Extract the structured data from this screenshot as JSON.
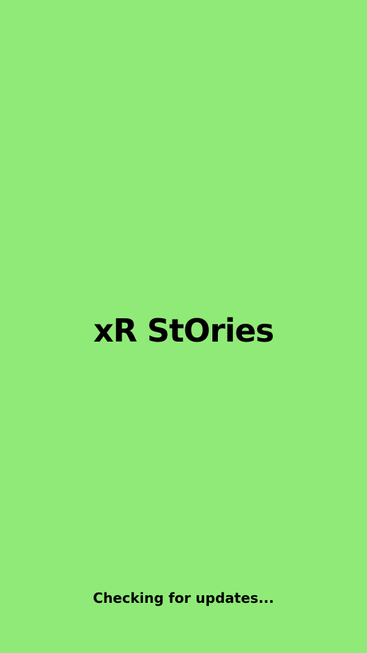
{
  "splash": {
    "logo_text": "xR StOries",
    "status_text": "Checking for updates...",
    "background_color": "#90EA78",
    "text_color": "#000000"
  }
}
